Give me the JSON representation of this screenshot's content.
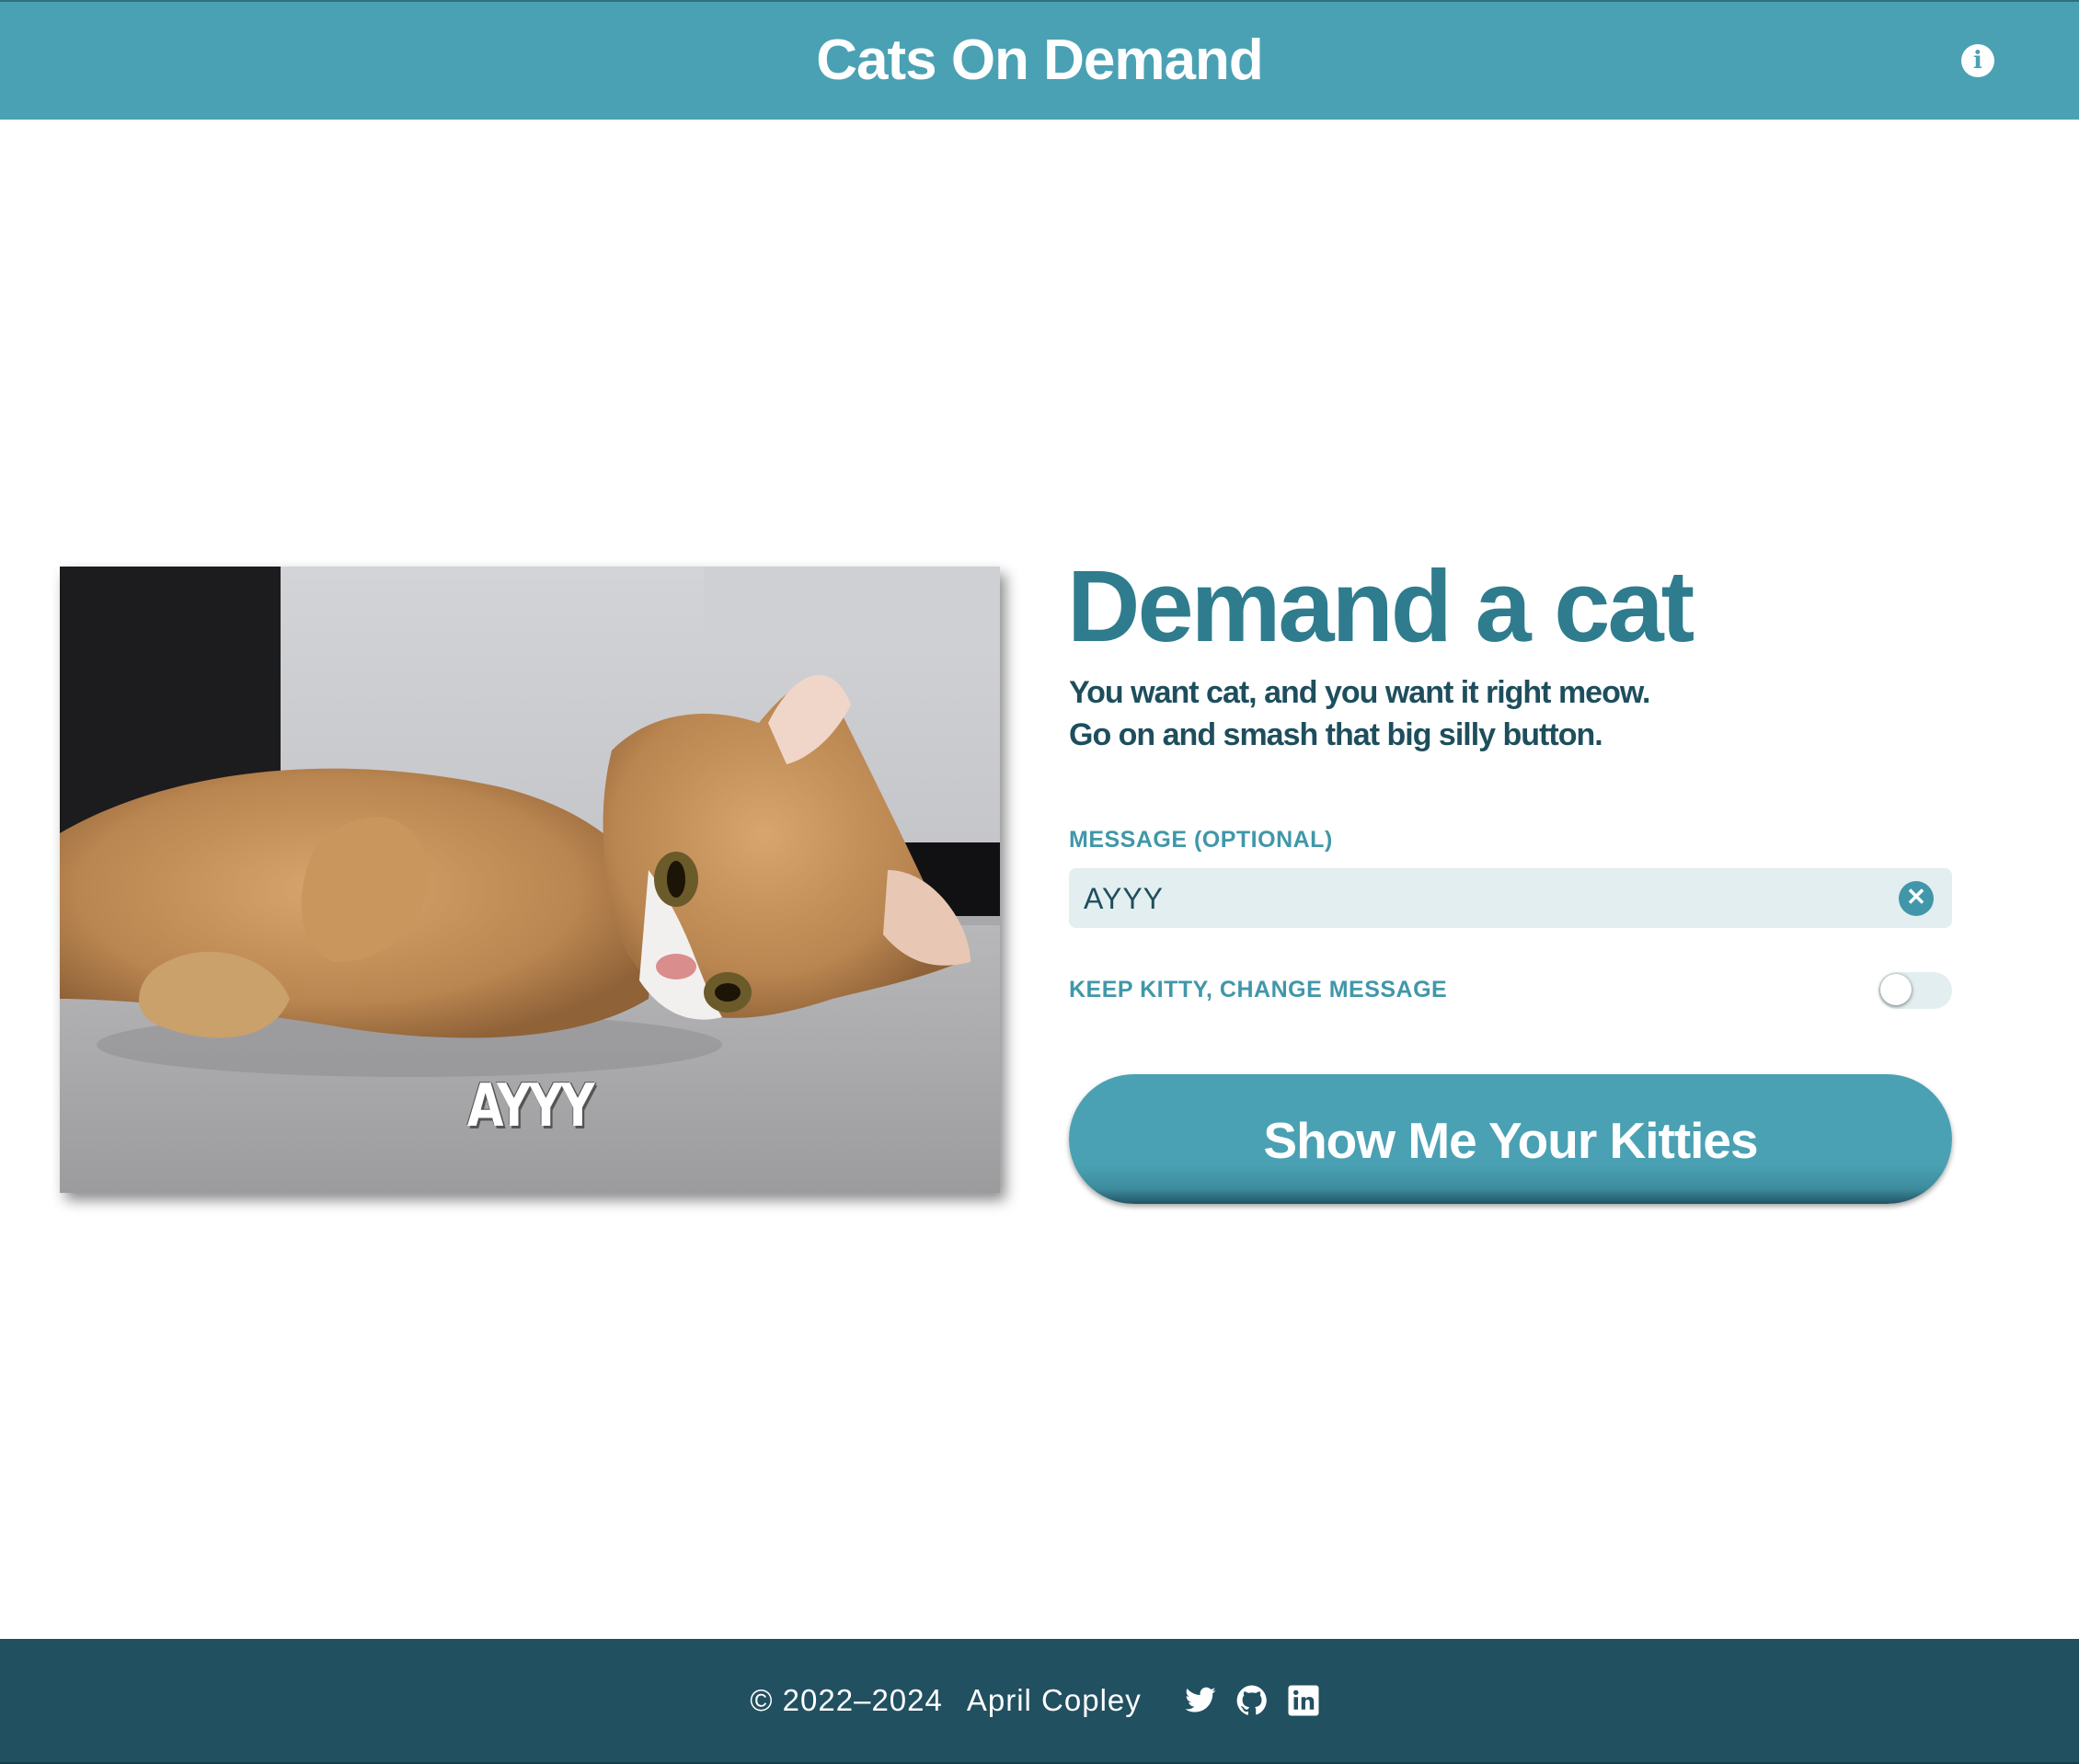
{
  "header": {
    "title": "Cats On Demand",
    "info_icon": "info-icon",
    "info_glyph": "i"
  },
  "image": {
    "meme_text": "AYYY"
  },
  "main": {
    "headline": "Demand a cat",
    "tagline_line1": "You want cat, and you want it right meow.",
    "tagline_line2": "Go on and smash that big silly button."
  },
  "form": {
    "message_label": "MESSAGE (OPTIONAL)",
    "message_value": "AYYY",
    "clear_icon": "close-circle-icon",
    "keep_label": "KEEP KITTY, CHANGE MESSAGE",
    "keep_toggle_on": false,
    "submit_label": "Show Me Your Kitties"
  },
  "footer": {
    "copyright": "© 2022–2024",
    "author": "April Copley",
    "social_icons": [
      "twitter-icon",
      "github-icon",
      "linkedin-icon"
    ]
  },
  "colors": {
    "header_bg": "#4aa1b3",
    "footer_bg": "#215060",
    "headline": "#2f7c8e",
    "text_dark": "#1e4e5d",
    "label": "#4197a9",
    "input_bg": "#e2eef0"
  }
}
